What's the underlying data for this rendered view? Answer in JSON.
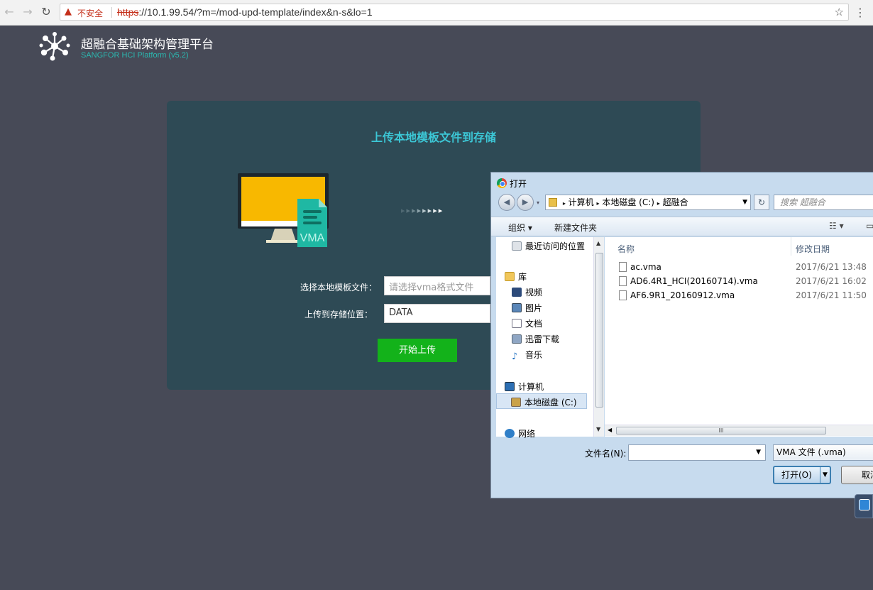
{
  "browser": {
    "insecure_label": "不安全",
    "url_scheme": "https",
    "url_rest": "://10.1.99.54/?m=/mod-upd-template/index&n-s&lo=1"
  },
  "app": {
    "title": "超融合基础架构管理平台",
    "subtitle": "SANGFOR HCI Platform (v5.2)"
  },
  "upload": {
    "heading": "上传本地模板文件到存储",
    "vma_badge": "VMA",
    "file_label": "选择本地模板文件：",
    "file_placeholder": "请选择vma格式文件",
    "storage_label": "上传到存储位置：",
    "storage_value": "DATA",
    "start_button": "开始上传"
  },
  "dialog": {
    "title": "打开",
    "breadcrumb": [
      "计算机",
      "本地磁盘 (C:)",
      "超融合"
    ],
    "search_placeholder": "搜索 超融合",
    "toolbar": {
      "organize": "组织 ▾",
      "new_folder": "新建文件夹"
    },
    "nav_items": [
      {
        "label": "最近访问的位置"
      },
      {
        "label": "库"
      },
      {
        "label": "视频"
      },
      {
        "label": "图片"
      },
      {
        "label": "文档"
      },
      {
        "label": "迅雷下载"
      },
      {
        "label": "音乐"
      },
      {
        "label": "计算机"
      },
      {
        "label": "本地磁盘 (C:)"
      },
      {
        "label": "网络"
      }
    ],
    "columns": {
      "name": "名称",
      "modified": "修改日期"
    },
    "files": [
      {
        "name": "ac.vma",
        "modified": "2017/6/21 13:48"
      },
      {
        "name": "AD6.4R1_HCI(20160714).vma",
        "modified": "2017/6/21 16:02"
      },
      {
        "name": "AF6.9R1_20160912.vma",
        "modified": "2017/6/21 11:50"
      }
    ],
    "filename_label": "文件名(N):",
    "filetype": "VMA 文件 (.vma)",
    "open_button": "打开(O)",
    "cancel_button": "取消"
  },
  "colors": {
    "background": "#474a57",
    "panel": "#2e4a55",
    "accent": "#3cc7d6",
    "start_button": "#13b21a",
    "monitor_screen": "#f8b800",
    "vma_file": "#1fb8a3"
  }
}
